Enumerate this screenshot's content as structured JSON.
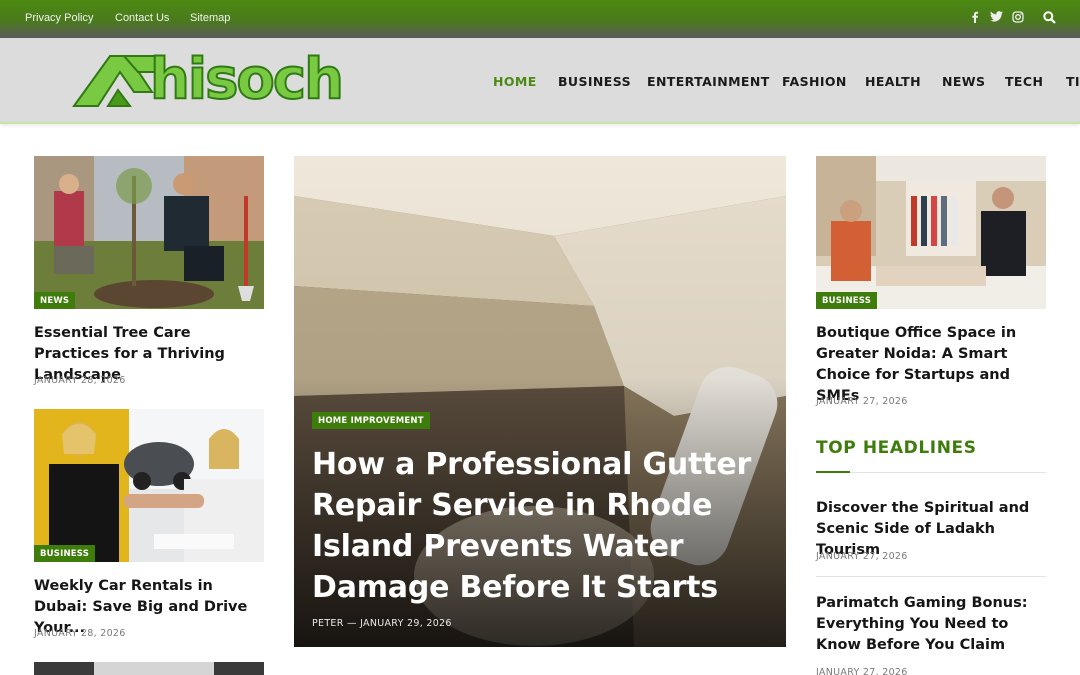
{
  "topbar": {
    "links": [
      "Privacy Policy",
      "Contact Us",
      "Sitemap"
    ],
    "social_icons": [
      "facebook-icon",
      "twitter-icon",
      "instagram-icon"
    ],
    "search_icon": "search-icon"
  },
  "header": {
    "logo_text": "hisoch",
    "logo_letter": "A",
    "nav": [
      "HOME",
      "BUSINESS",
      "ENTERTAINMENT",
      "FASHION",
      "HEALTH",
      "NEWS",
      "TECH",
      "TI"
    ],
    "active_nav": "HOME"
  },
  "left_column": [
    {
      "badge": "NEWS",
      "title": "Essential Tree Care Practices for a Thriving Landscape",
      "date": "JANUARY 28, 2026"
    },
    {
      "badge": "BUSINESS",
      "title": "Weekly Car Rentals in Dubai: Save Big and Drive Your...",
      "date": "JANUARY 28, 2026"
    }
  ],
  "hero": {
    "badge": "HOME IMPROVEMENT",
    "title": "How a Professional Gutter Repair Service in Rhode Island Prevents Water Damage Before It Starts",
    "author": "PETER",
    "separator": "—",
    "date": "JANUARY 29, 2026"
  },
  "right_column": {
    "feature": {
      "badge": "BUSINESS",
      "title": "Boutique Office Space in Greater Noida: A Smart Choice for Startups and SMEs",
      "date": "JANUARY 27, 2026"
    },
    "section_title": "TOP HEADLINES",
    "headlines": [
      {
        "title": "Discover the Spiritual and Scenic Side of Ladakh Tourism",
        "date": "JANUARY 27, 2026"
      },
      {
        "title": "Parimatch Gaming Bonus: Everything You Need to Know Before You Claim",
        "date": "JANUARY 27, 2026"
      }
    ]
  },
  "colors": {
    "accent": "#3e7d0b",
    "topbar": "#4c8a12",
    "header_bg": "#dcdcdc",
    "logo_green": "#7ac943"
  }
}
